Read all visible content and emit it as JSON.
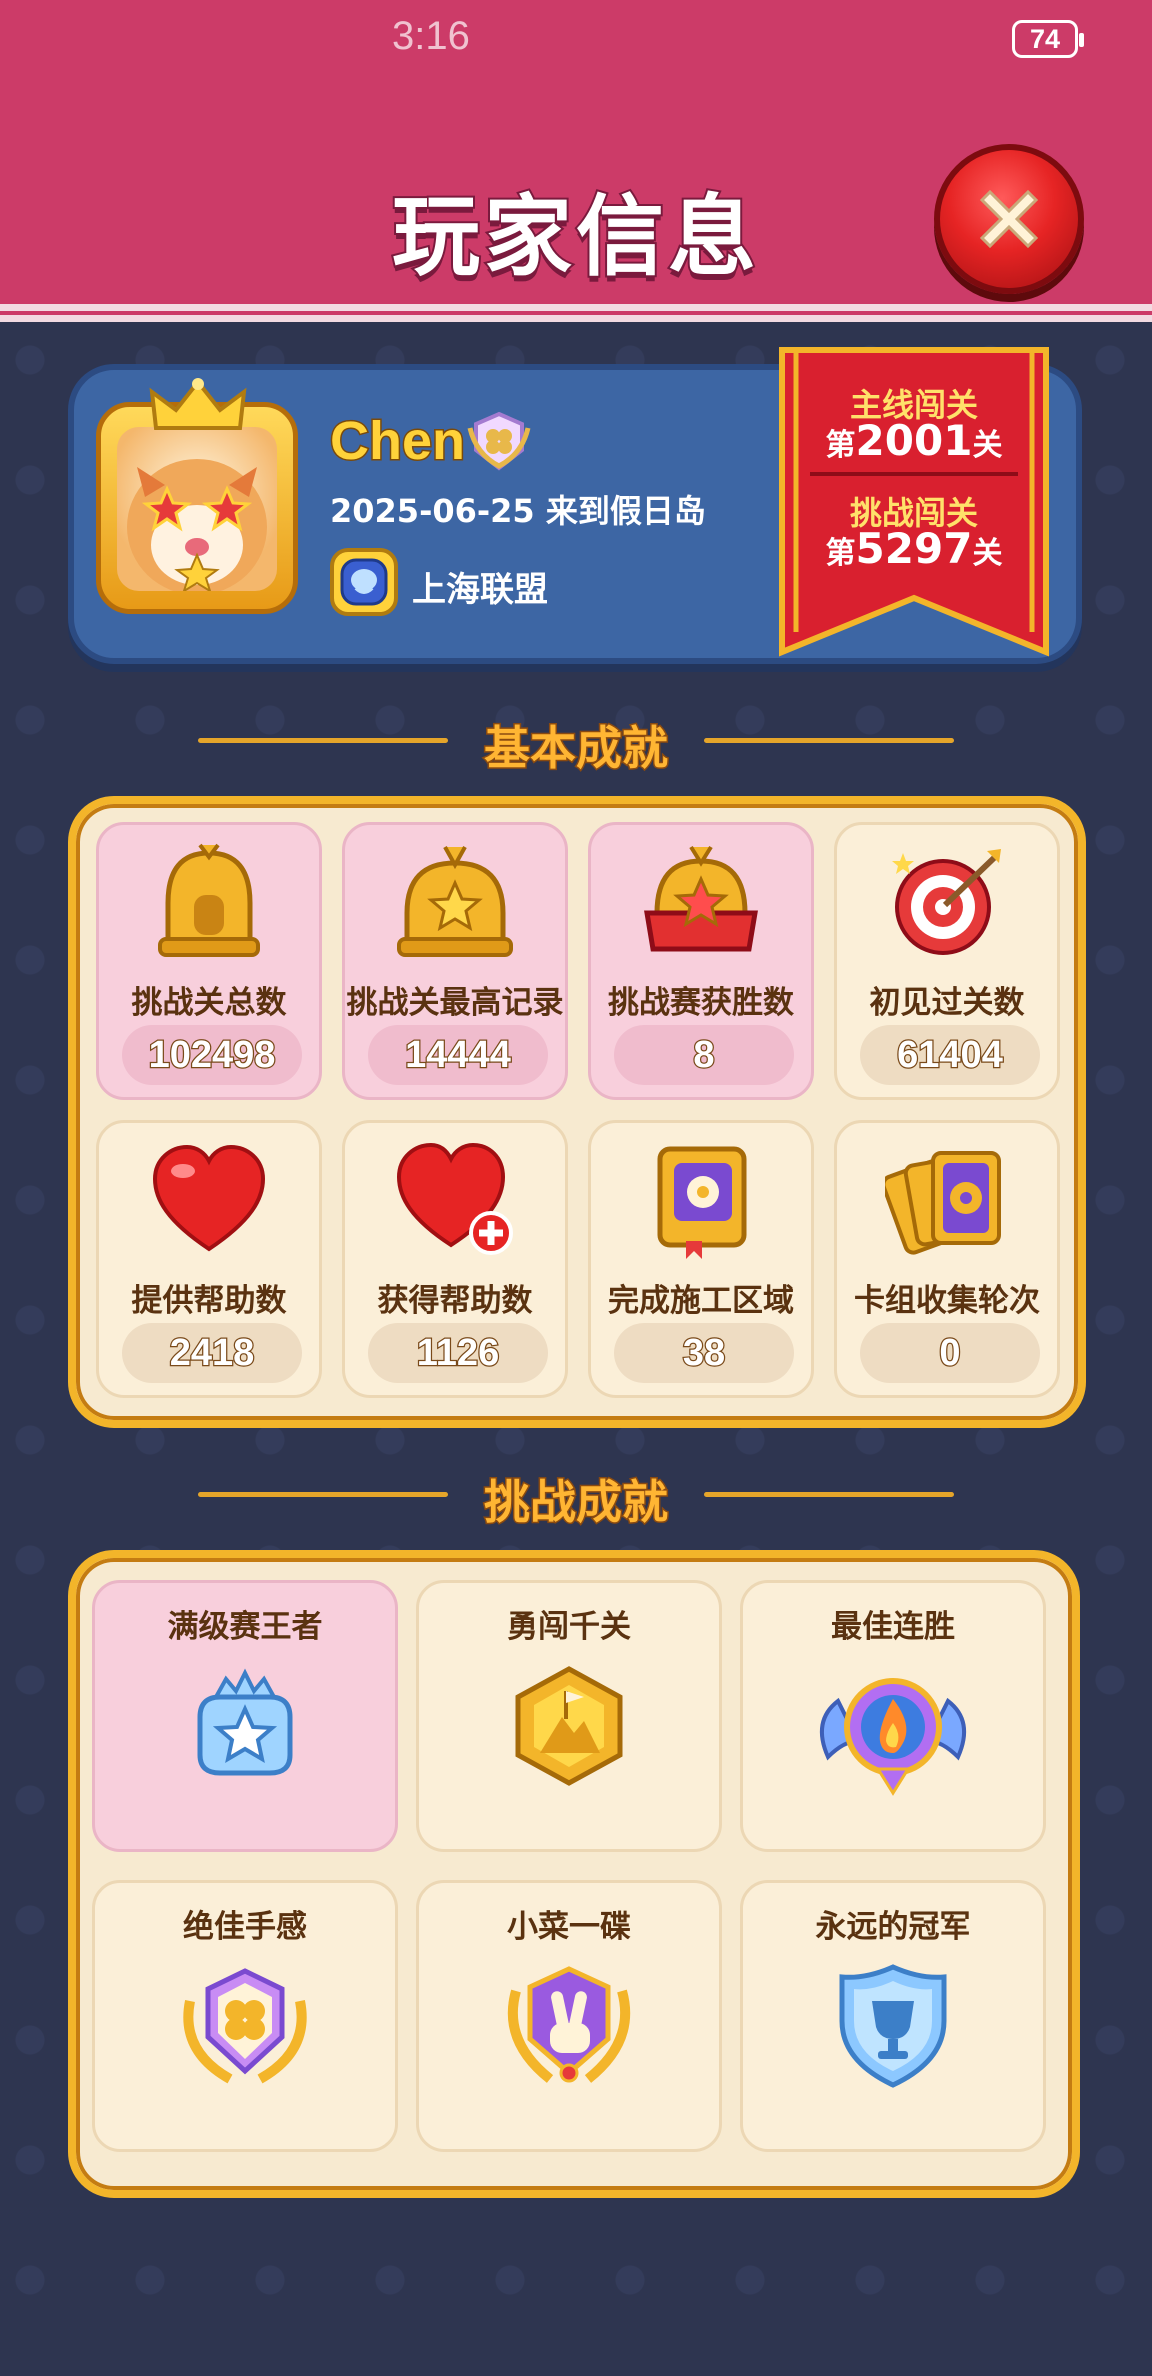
{
  "status": {
    "time": "3:16",
    "battery": "74"
  },
  "header": {
    "title": "玩家信息"
  },
  "player": {
    "name": "Chen",
    "join_date": "2025-06-25 来到假日岛",
    "alliance": "上海联盟"
  },
  "progress": {
    "main_label": "主线闯关",
    "main_prefix": "第",
    "main_level": "2001",
    "main_suffix": "关",
    "challenge_label": "挑战闯关",
    "challenge_prefix": "第",
    "challenge_level": "5297",
    "challenge_suffix": "关"
  },
  "basic": {
    "title": "基本成就",
    "stats": [
      {
        "label": "挑战关总数",
        "value": "102498",
        "icon": "house-trophy-icon"
      },
      {
        "label": "挑战关最高记录",
        "value": "14444",
        "icon": "star-trophy-icon"
      },
      {
        "label": "挑战赛获胜数",
        "value": "8",
        "icon": "red-star-trophy-icon"
      },
      {
        "label": "初见过关数",
        "value": "61404",
        "icon": "target-icon"
      },
      {
        "label": "提供帮助数",
        "value": "2418",
        "icon": "heart-icon"
      },
      {
        "label": "获得帮助数",
        "value": "1126",
        "icon": "heart-plus-icon"
      },
      {
        "label": "完成施工区域",
        "value": "38",
        "icon": "book-icon"
      },
      {
        "label": "卡组收集轮次",
        "value": "0",
        "icon": "cards-icon"
      }
    ]
  },
  "challenge": {
    "title": "挑战成就",
    "items": [
      {
        "label": "满级赛王者",
        "icon": "crown-star-badge-icon"
      },
      {
        "label": "勇闯千关",
        "icon": "mountain-flag-badge-icon"
      },
      {
        "label": "最佳连胜",
        "icon": "flame-wing-medal-icon"
      },
      {
        "label": "绝佳手感",
        "icon": "clover-laurel-badge-icon"
      },
      {
        "label": "小菜一碟",
        "icon": "peace-hand-badge-icon"
      },
      {
        "label": "永远的冠军",
        "icon": "cup-shield-icon"
      }
    ]
  },
  "colors": {
    "header": "#cc3b68",
    "background": "#2e3550",
    "profile_card": "#3d66a4",
    "banner": "#d9202f",
    "panel_border": "#f3b52a"
  }
}
